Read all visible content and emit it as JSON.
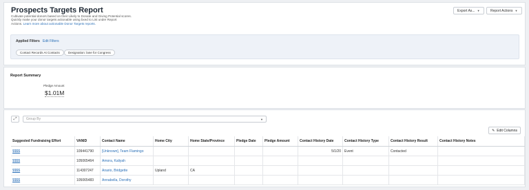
{
  "header": {
    "title": "Prospects Targets Report",
    "desc_line1": "Cultivate potential donors based on their Likely to Donate and Giving Potential scores.",
    "desc_line2": "Quickly make your donor targets actionable using bxed to List under Report",
    "desc_line3_prefix": "Actions.",
    "desc_link": "Learn more about actionable Donor Targets reports.",
    "export_label": "Export As...",
    "actions_label": "Report Actions"
  },
  "filters": {
    "applied_label": "Applied Filters",
    "edit_label": "Edit Filters",
    "chips": [
      "Contact Records At Contacts",
      "Designation: lane for Congress"
    ]
  },
  "summary": {
    "title": "Report Summary",
    "pledge_label": "Pledge Amount",
    "pledge_value": "$1.01M"
  },
  "table": {
    "group_by_placeholder": "Group By",
    "edit_columns_label": "Edit Columns",
    "columns": [
      "Suggested Fundraising Effort",
      "VANID",
      "Contact Name",
      "Home City",
      "Home State/Province",
      "Pledge Date",
      "Pledge Amount",
      "Contact History Date",
      "Contact History Type",
      "Contact History Result",
      "Contact History Notes"
    ],
    "rows": [
      [
        "$$$$",
        "109441790",
        "[Unknown], Team Flamingo",
        "",
        "",
        "",
        "",
        "5/1/20",
        "Event",
        "Contacted",
        ""
      ],
      [
        "$$$$",
        "105065464",
        "Amora, Kaliyah",
        "",
        "",
        "",
        "",
        "",
        "",
        "",
        ""
      ],
      [
        "$$$$",
        "114307247",
        "Anario, Bridgette",
        "Upland",
        "CA",
        "",
        "",
        "",
        "",
        "",
        ""
      ],
      [
        "$$$$",
        "105065483",
        "Annabella, Dorothy",
        "",
        "",
        "",
        "",
        "",
        "",
        "",
        ""
      ]
    ]
  }
}
